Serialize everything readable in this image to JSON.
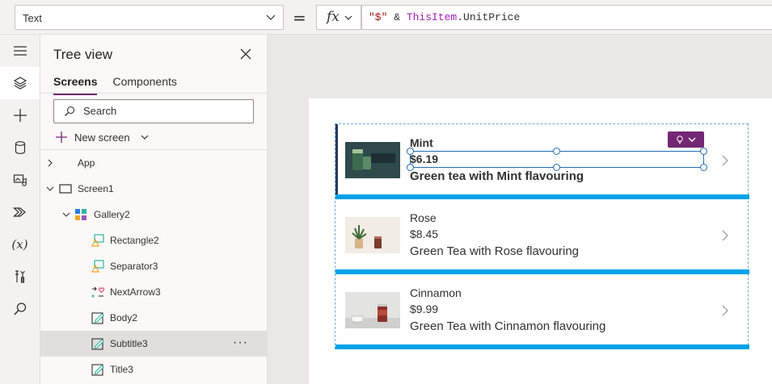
{
  "formula_bar": {
    "property": "Text",
    "equals": "=",
    "fx_label": "fx",
    "formula": {
      "string_literal": "\"$\"",
      "operator": " & ",
      "control": "ThisItem",
      "property": ".UnitPrice"
    }
  },
  "rail": {
    "items": [
      "hamburger-icon",
      "layers-icon",
      "plus-icon",
      "database-icon",
      "media-icon",
      "power-automate-icon",
      "variables-icon",
      "tools-icon",
      "search-icon"
    ],
    "variables_label": "(x)"
  },
  "tree_view": {
    "title": "Tree view",
    "tabs": [
      {
        "label": "Screens",
        "active": true
      },
      {
        "label": "Components",
        "active": false
      }
    ],
    "search_placeholder": "Search",
    "new_screen_label": "New screen",
    "nodes": [
      {
        "label": "App",
        "icon": "app-icon"
      },
      {
        "label": "Screen1",
        "icon": "screen-icon"
      },
      {
        "label": "Gallery2",
        "icon": "gallery-icon"
      },
      {
        "label": "Rectangle2",
        "icon": "shape-icon"
      },
      {
        "label": "Separator3",
        "icon": "shape-icon"
      },
      {
        "label": "NextArrow3",
        "icon": "arrow-icon"
      },
      {
        "label": "Body2",
        "icon": "edit-text-icon"
      },
      {
        "label": "Subtitle3",
        "icon": "edit-text-icon",
        "selected": true,
        "more": "···"
      },
      {
        "label": "Title3",
        "icon": "edit-text-icon"
      }
    ]
  },
  "gallery": {
    "items": [
      {
        "title": "Mint",
        "price": "$6.19",
        "description": "Green tea with Mint flavouring"
      },
      {
        "title": "Rose",
        "price": "$8.45",
        "description": "Green Tea with Rose flavouring"
      },
      {
        "title": "Cinnamon",
        "price": "$9.99",
        "description": "Green Tea with Cinnamon flavouring"
      }
    ]
  },
  "colors": {
    "accent": "#742774",
    "separator": "#00a2e8",
    "selection": "#1e6db6"
  }
}
